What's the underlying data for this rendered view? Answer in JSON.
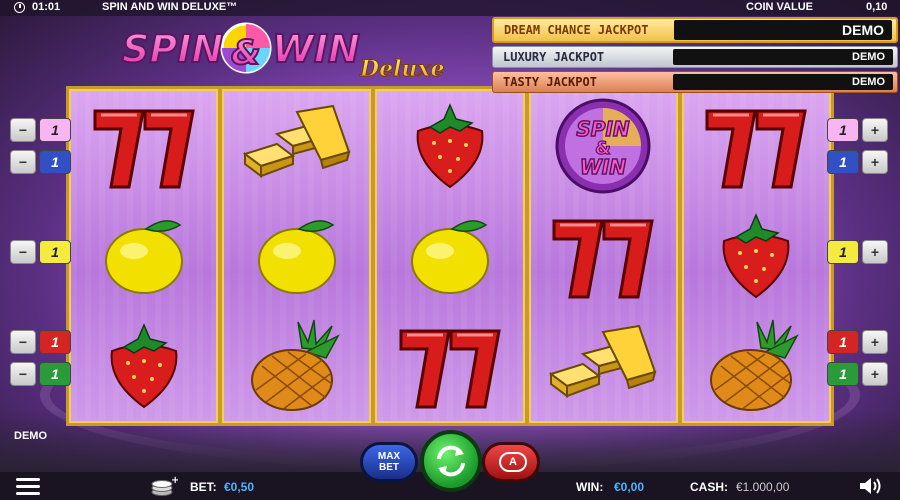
{
  "top_bar": {
    "time": "01:01",
    "game_title": "SPIN AND WIN DELUXE™",
    "coin_value_label": "COIN VALUE",
    "coin_value": "0,10"
  },
  "logo": {
    "spin": "SPIN",
    "win": "WIN",
    "deluxe": "Deluxe"
  },
  "jackpots": [
    {
      "name": "DREAM CHANCE JACKPOT",
      "value": "DEMO"
    },
    {
      "name": "LUXURY JACKPOT",
      "value": "DEMO"
    },
    {
      "name": "TASTY JACKPOT",
      "value": "DEMO"
    }
  ],
  "reels": [
    [
      "seven-symbol",
      "lemon-symbol",
      "strawberry-symbol"
    ],
    [
      "gold-bars-symbol",
      "lemon-symbol",
      "pineapple-symbol"
    ],
    [
      "strawberry-symbol",
      "lemon-symbol",
      "seven-symbol"
    ],
    [
      "spin-and-win-symbol",
      "seven-symbol",
      "gold-bars-symbol"
    ],
    [
      "seven-symbol",
      "strawberry-symbol",
      "pineapple-symbol"
    ]
  ],
  "scatter_text": {
    "line1": "SPIN",
    "line2": "&",
    "line3": "WIN"
  },
  "paylines": {
    "left": [
      {
        "minus": "−",
        "number": "1",
        "color": "pink"
      },
      {
        "minus": "−",
        "number": "1",
        "color": "blue"
      },
      {
        "minus": "−",
        "number": "1",
        "color": "yellow"
      },
      {
        "minus": "−",
        "number": "1",
        "color": "red"
      },
      {
        "minus": "−",
        "number": "1",
        "color": "green"
      }
    ],
    "right": [
      {
        "number": "1",
        "plus": "+",
        "color": "pink"
      },
      {
        "number": "1",
        "plus": "+",
        "color": "blue"
      },
      {
        "number": "1",
        "plus": "+",
        "color": "yellow"
      },
      {
        "number": "1",
        "plus": "+",
        "color": "red"
      },
      {
        "number": "1",
        "plus": "+",
        "color": "green"
      }
    ]
  },
  "demo_label": "DEMO",
  "controls": {
    "max_bet_line1": "MAX",
    "max_bet_line2": "BET",
    "autoplay_glyph": "A"
  },
  "bottom_bar": {
    "bet_label": "BET:",
    "bet_value": "€0,50",
    "win_label": "WIN:",
    "win_value": "€0,00",
    "cash_label": "CASH:",
    "cash_value": "€1.000,00"
  },
  "colors": {
    "accent_blue": "#4ab6ff",
    "reel_frame": "#c89a2a",
    "spin_green": "#1a9a2a"
  }
}
